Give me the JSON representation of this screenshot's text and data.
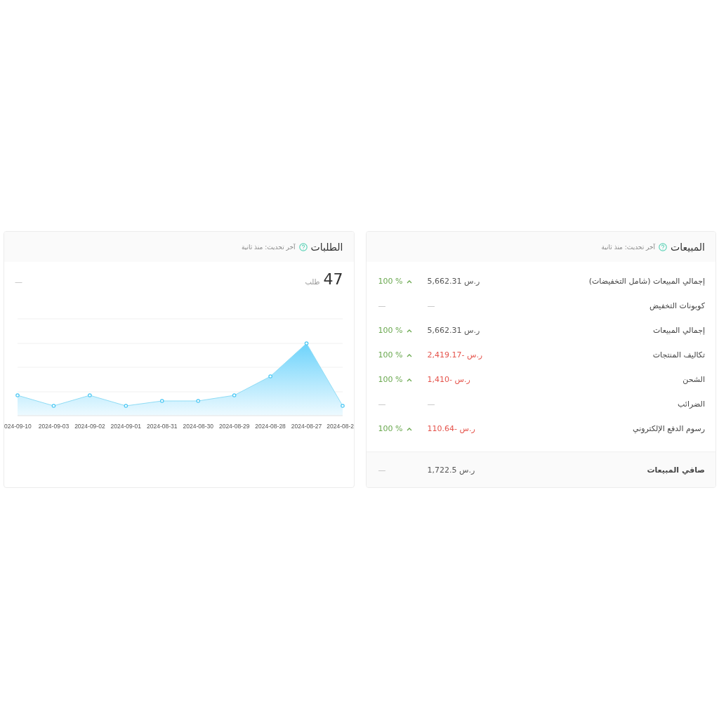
{
  "sales_card": {
    "title": "المبيعات",
    "updated": "آخر تحديث: منذ ثانية",
    "rows": [
      {
        "label": "إجمالي المبيعات (شامل التخفيضات)",
        "value": "5,662.31 ر.س",
        "negative": false,
        "blank": false,
        "change": "100 %",
        "rising": true
      },
      {
        "label": "كوبونات التخفيض",
        "value": "—",
        "negative": false,
        "blank": true,
        "change": "—",
        "rising": false
      },
      {
        "label": "إجمالي المبيعات",
        "value": "5,662.31 ر.س",
        "negative": false,
        "blank": false,
        "change": "100 %",
        "rising": true
      },
      {
        "label": "تكاليف المنتجات",
        "value": "ر.س -2,419.17",
        "negative": true,
        "blank": false,
        "change": "100 %",
        "rising": true
      },
      {
        "label": "الشحن",
        "value": "ر.س -1,410",
        "negative": true,
        "blank": false,
        "change": "100 %",
        "rising": true
      },
      {
        "label": "الضرائب",
        "value": "—",
        "negative": false,
        "blank": true,
        "change": "—",
        "rising": false
      },
      {
        "label": "رسوم الدفع الإلكتروني",
        "value": "ر.س -110.64",
        "negative": true,
        "blank": false,
        "change": "100 %",
        "rising": true
      }
    ],
    "total": {
      "label": "صافي المبيعات",
      "value": "1,722.5 ر.س",
      "negative": false,
      "blank": false,
      "change": "—",
      "rising": false
    }
  },
  "orders_card": {
    "title": "الطلبات",
    "updated": "آخر تحديث: منذ ثانية",
    "count": "47",
    "unit": "طلب",
    "change": "—",
    "chart_x_labels": [
      "2024-08-2",
      "2024-08-27",
      "2024-08-28",
      "2024-08-29",
      "2024-08-30",
      "2024-08-31",
      "2024-09-01",
      "2024-09-02",
      "2024-09-03",
      "024-09-10"
    ]
  }
}
